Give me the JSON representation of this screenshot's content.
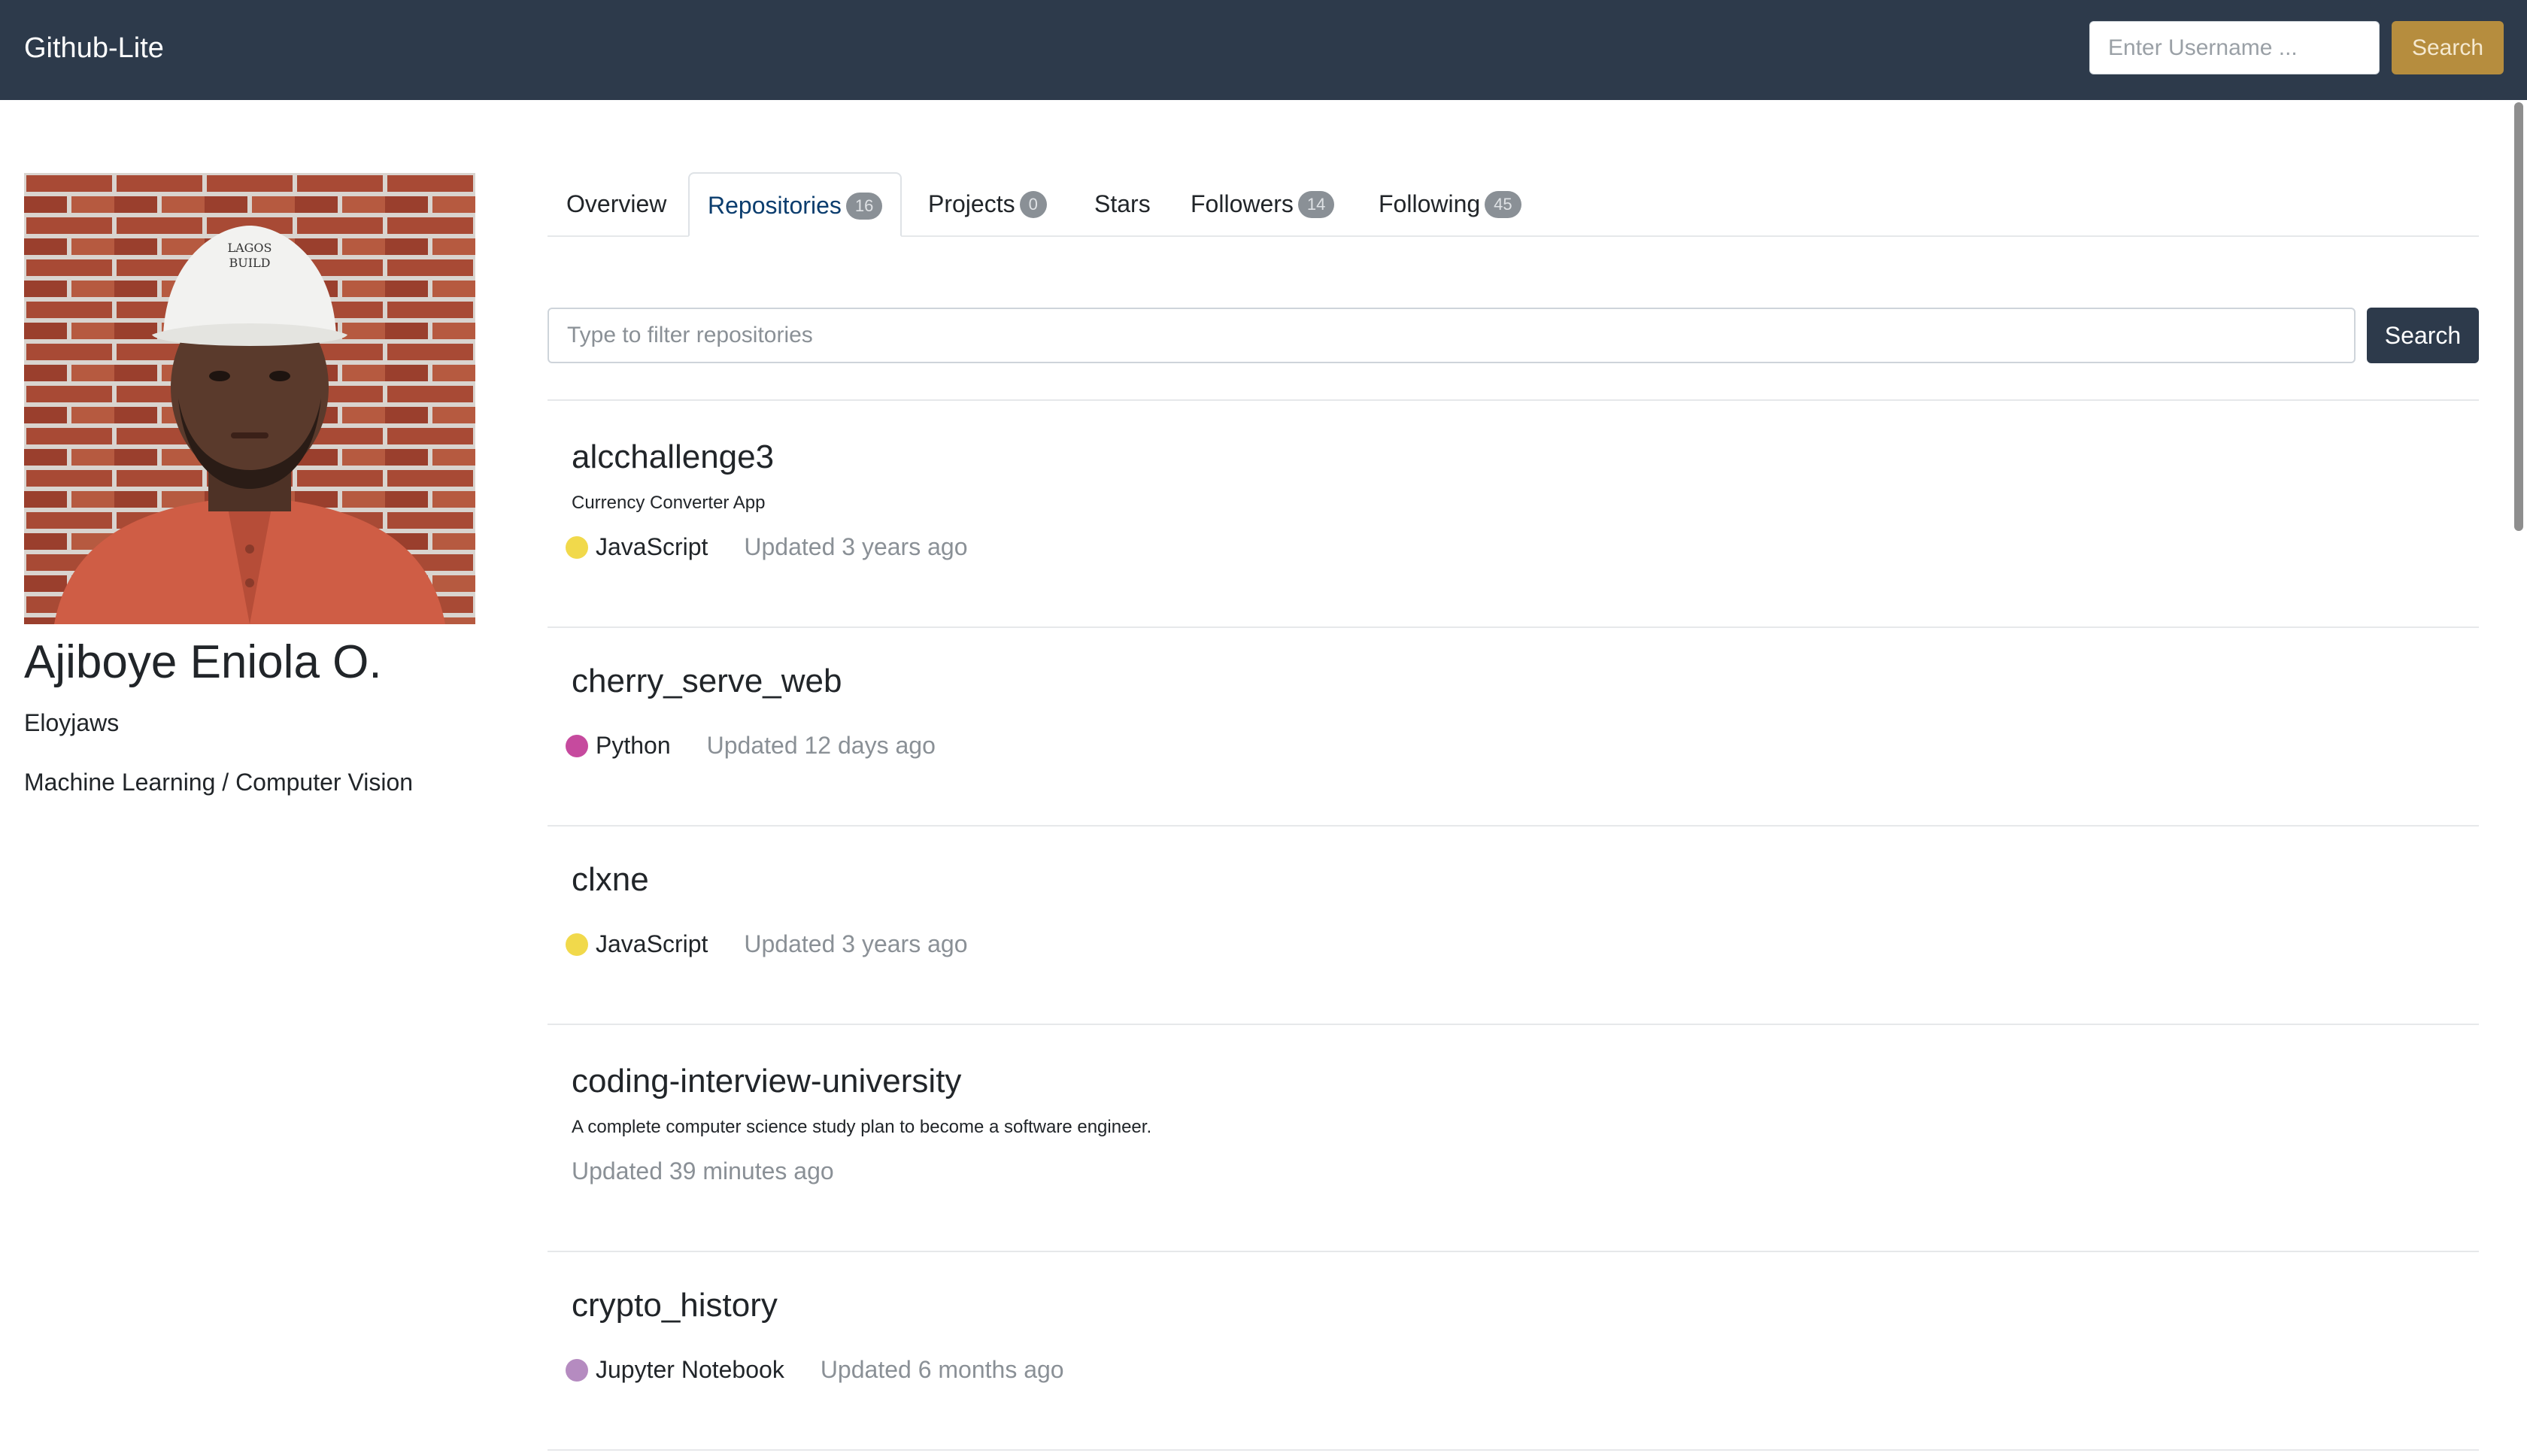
{
  "app": {
    "brand": "Github-Lite"
  },
  "header": {
    "username_placeholder": "Enter Username ...",
    "search_label": "Search"
  },
  "profile": {
    "name": "Ajiboye Eniola O.",
    "username": "Eloyjaws",
    "bio": "Machine Learning / Computer Vision",
    "cap_text": [
      "LAGOS",
      "BUILD"
    ]
  },
  "tabs": [
    {
      "label": "Overview",
      "count": null,
      "active": false
    },
    {
      "label": "Repositories",
      "count": "16",
      "active": true
    },
    {
      "label": "Projects",
      "count": "0",
      "active": false
    },
    {
      "label": "Stars",
      "count": null,
      "active": false
    },
    {
      "label": "Followers",
      "count": "14",
      "active": false
    },
    {
      "label": "Following",
      "count": "45",
      "active": false
    }
  ],
  "filter": {
    "placeholder": "Type to filter repositories",
    "button_label": "Search"
  },
  "repos": [
    {
      "name": "alcchallenge3",
      "description": "Currency Converter App",
      "language": "JavaScript",
      "language_color": "#f1d94b",
      "updated": "Updated 3 years ago"
    },
    {
      "name": "cherry_serve_web",
      "description": "",
      "language": "Python",
      "language_color": "#c64a9e",
      "updated": "Updated 12 days ago"
    },
    {
      "name": "clxne",
      "description": "",
      "language": "JavaScript",
      "language_color": "#f1d94b",
      "updated": "Updated 3 years ago"
    },
    {
      "name": "coding-interview-university",
      "description": "A complete computer science study plan to become a software engineer.",
      "language": "",
      "language_color": "",
      "updated": "Updated 39 minutes ago"
    },
    {
      "name": "crypto_history",
      "description": "",
      "language": "Jupyter Notebook",
      "language_color": "#b58bc0",
      "updated": "Updated 6 months ago"
    }
  ]
}
